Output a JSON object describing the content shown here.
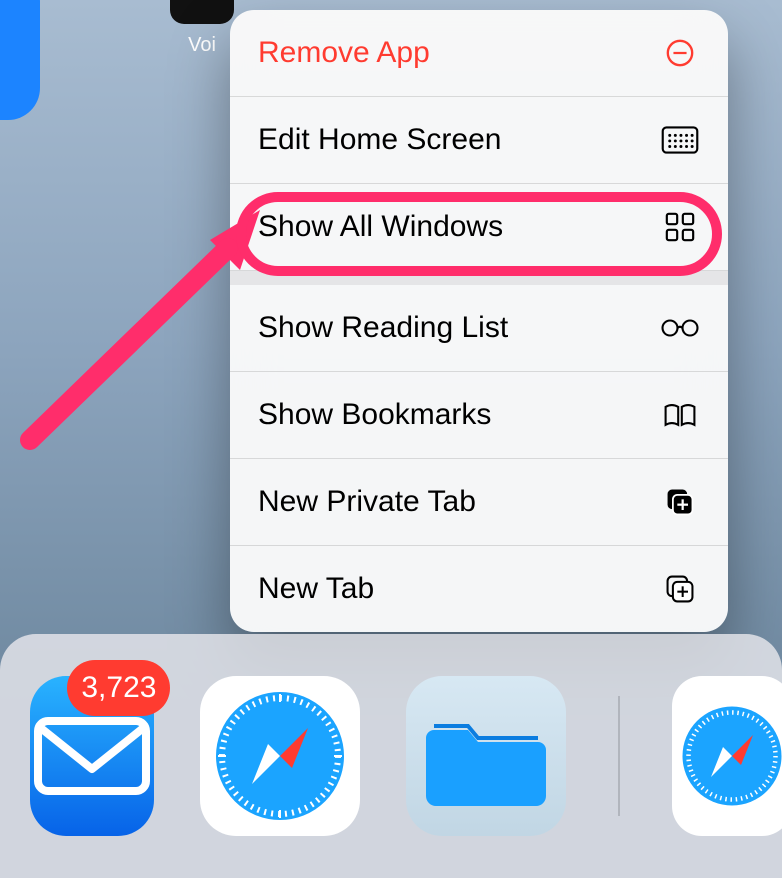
{
  "home": {
    "voicememo_label": "Voi"
  },
  "menu": {
    "remove": "Remove App",
    "edit": "Edit Home Screen",
    "showWindows": "Show All Windows",
    "readingList": "Show Reading List",
    "bookmarks": "Show Bookmarks",
    "privateTab": "New Private Tab",
    "newTab": "New Tab"
  },
  "dock": {
    "mail_badge": "3,723"
  }
}
